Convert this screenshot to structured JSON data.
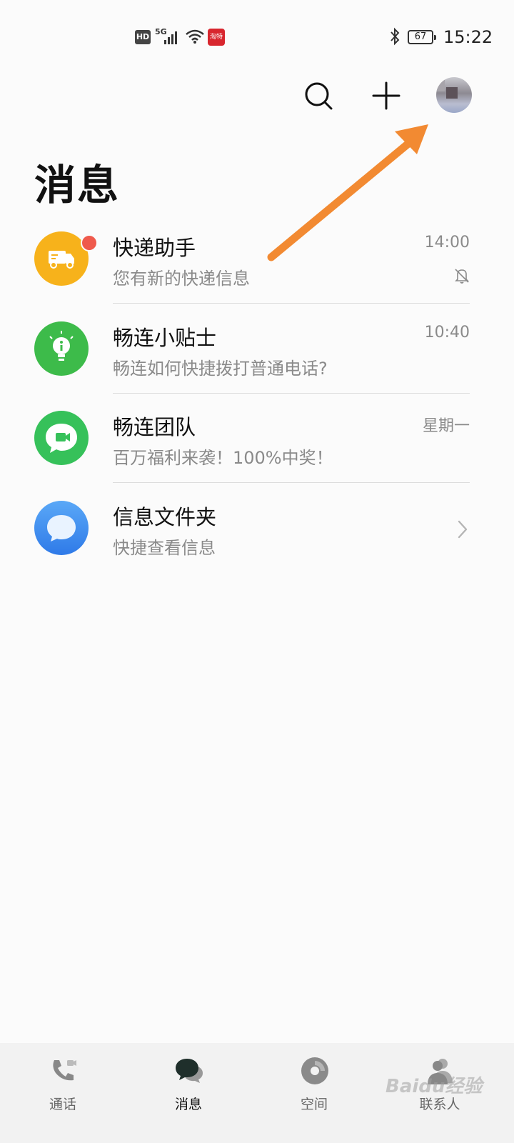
{
  "status_bar": {
    "hd": "HD",
    "network": "5G",
    "app_badge": "淘特",
    "battery": "67",
    "time": "15:22"
  },
  "header": {
    "search_icon": "search-icon",
    "add_icon": "plus-icon",
    "avatar": "avatar"
  },
  "page_title": "消息",
  "conversations": [
    {
      "title": "快递助手",
      "subtitle": "您有新的快递信息",
      "time": "14:00",
      "icon": "delivery-truck-icon",
      "color": "#f7b21b",
      "muted": true,
      "unread": true
    },
    {
      "title": "畅连小贴士",
      "subtitle": "畅连如何快捷拨打普通电话?",
      "time": "10:40",
      "icon": "lightbulb-icon",
      "color": "#3dbb4a"
    },
    {
      "title": "畅连团队",
      "subtitle": "百万福利来袭！100%中奖！",
      "time": "星期一",
      "icon": "video-chat-icon",
      "color": "#36c15a"
    },
    {
      "title": "信息文件夹",
      "subtitle": "快捷查看信息",
      "time": "",
      "icon": "message-folder-icon",
      "color": "#3f8ef0"
    }
  ],
  "bottom_nav": [
    {
      "label": "通话",
      "icon": "phone-icon"
    },
    {
      "label": "消息",
      "icon": "chat-bubbles-icon",
      "active": true
    },
    {
      "label": "空间",
      "icon": "space-icon"
    },
    {
      "label": "联系人",
      "icon": "contacts-icon"
    }
  ],
  "watermark": "Baidu经验",
  "colors": {
    "accent_arrow": "#f28a32",
    "badge_red": "#ef5a4c"
  }
}
